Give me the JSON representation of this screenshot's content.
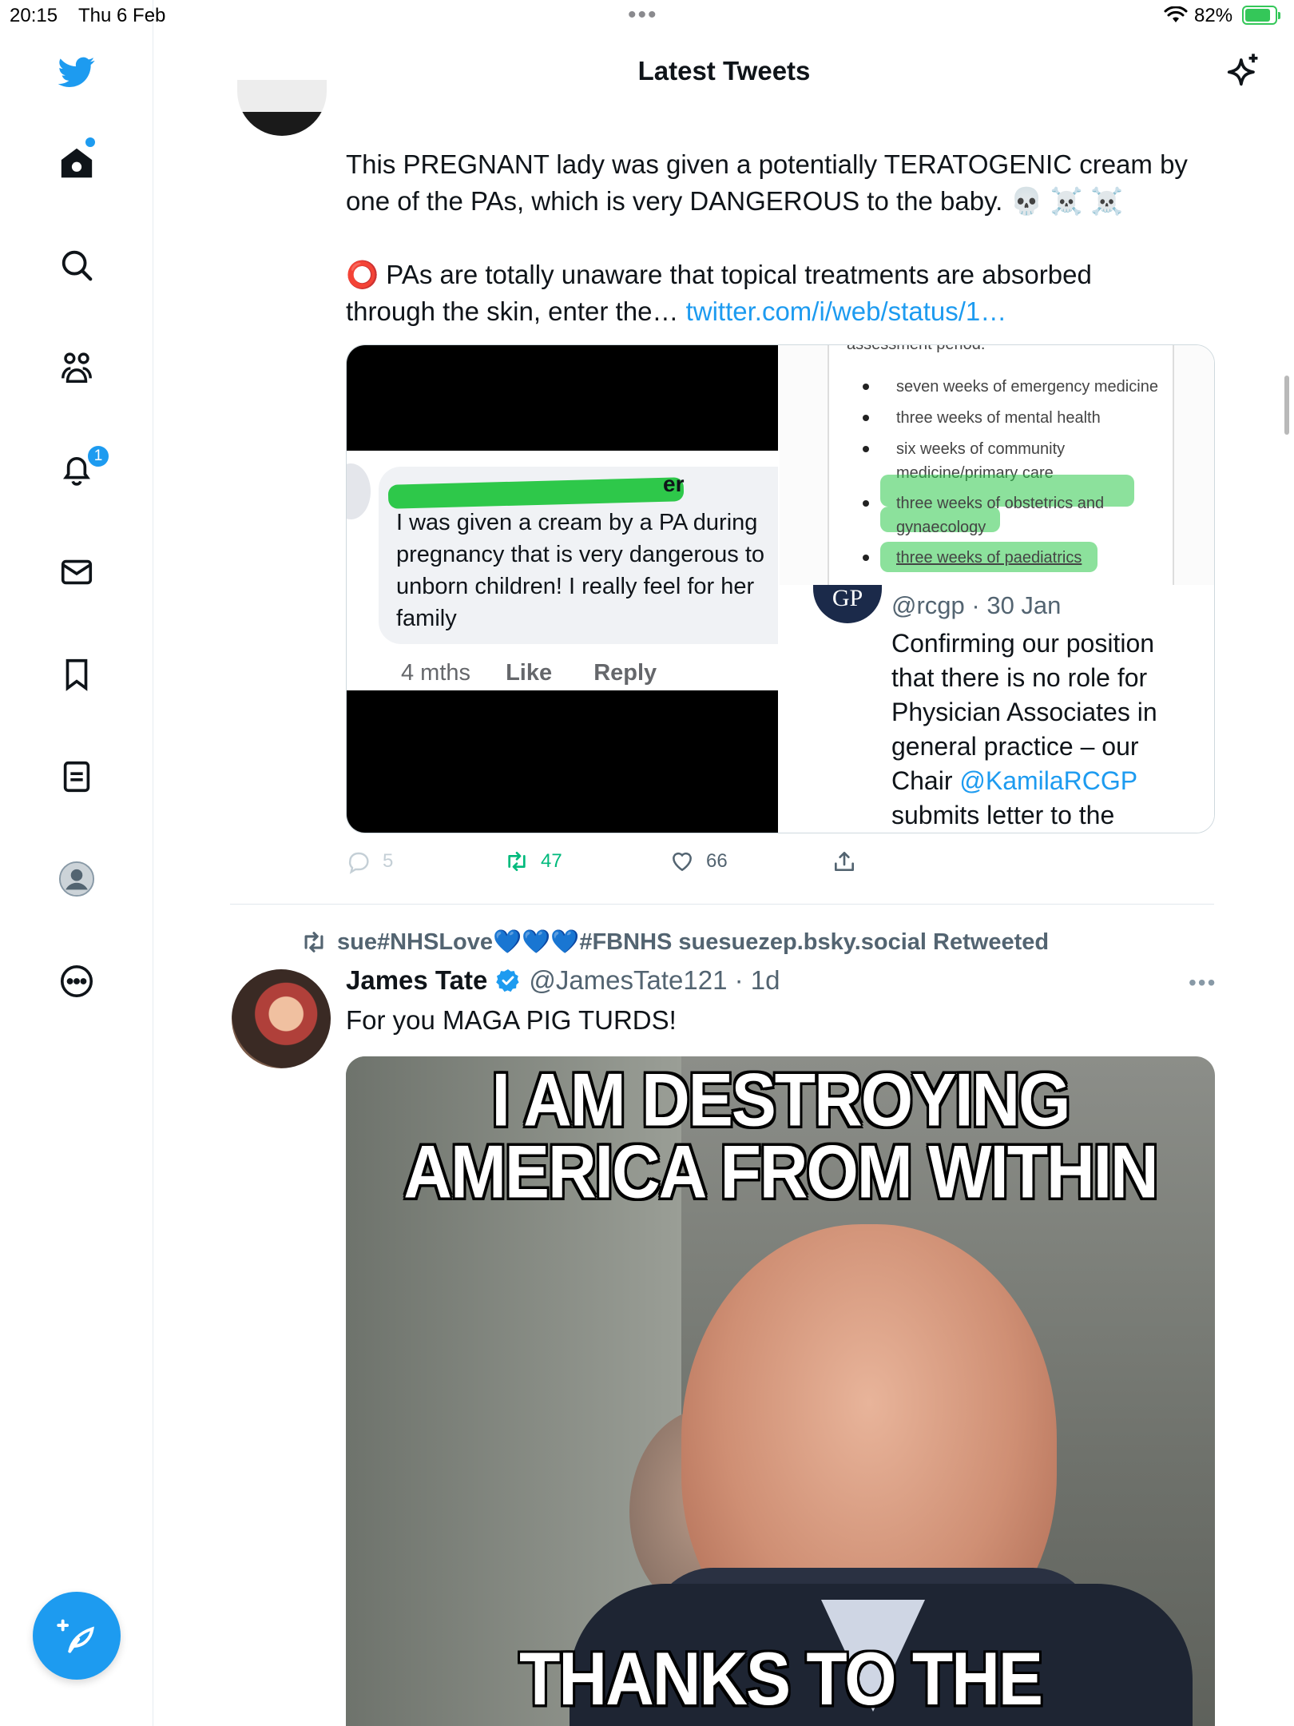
{
  "status_bar": {
    "time": "20:15",
    "date": "Thu 6 Feb",
    "battery_percent": "82%",
    "battery_level": 0.82,
    "accent": "#34c759"
  },
  "header": {
    "title": "Latest Tweets"
  },
  "sidebar": {
    "items": [
      {
        "name": "twitter-logo",
        "icon": "bird-icon"
      },
      {
        "name": "home",
        "icon": "home-icon"
      },
      {
        "name": "explore",
        "icon": "search-icon"
      },
      {
        "name": "communities",
        "icon": "people-icon"
      },
      {
        "name": "notifications",
        "icon": "bell-icon",
        "badge": "1"
      },
      {
        "name": "messages",
        "icon": "mail-icon"
      },
      {
        "name": "bookmarks",
        "icon": "bookmark-icon"
      },
      {
        "name": "lists",
        "icon": "list-icon"
      },
      {
        "name": "profile",
        "icon": "avatar-icon"
      },
      {
        "name": "more",
        "icon": "more-circle-icon"
      }
    ],
    "compose_icon": "compose-feather-icon",
    "brand_color": "#1d9bf0"
  },
  "tweet1": {
    "text_line1": "This PREGNANT lady was given a potentially TERATOGENIC cream by",
    "text_line2": "one of the PAs, which is very DANGEROUS to the baby. 💀 ☠️ ☠️",
    "text_line3": "⭕ PAs are totally unaware that topical treatments are absorbed",
    "text_line4_prefix": "through the skin, enter the… ",
    "link": "twitter.com/i/web/status/1…",
    "media_left": {
      "name_fragment": "er",
      "comment": "I was given a cream by a PA during\npregnancy that is very dangerous to\nunborn children! I really feel for her\nfamily",
      "age": "4 mths",
      "like": "Like",
      "reply": "Reply"
    },
    "media_right": {
      "doc_header": "assessment period.",
      "doc_items": [
        "seven weeks of emergency medicine",
        "three weeks of mental health",
        "six weeks of community",
        "medicine/primary care",
        "three weeks of obstetrics and",
        "gynaecology",
        "three weeks of paediatrics"
      ],
      "logo_text": "GP",
      "handle_date": "@rcgp · 30 Jan",
      "body_before_mention": "Confirming our position\nthat there is no role for\nPhysician Associates in\ngeneral practice – our\nChair ",
      "mention": "@KamilaRCGP",
      "body_after_mention": "\nsubmits letter to the"
    },
    "actions": {
      "replies": "5",
      "retweets": "47",
      "likes": "66"
    }
  },
  "tweet2": {
    "retweeted_by": "sue#NHSLove💙💙💙#FBNHS suesuezep.bsky.social Retweeted",
    "author_name": "James Tate",
    "verified": true,
    "handle_time": "@JamesTate121 · 1d",
    "text": "For you MAGA PIG TURDS!",
    "meme_top_line1": "I AM DESTROYING",
    "meme_top_line2": "AMERICA FROM WITHIN",
    "meme_bottom": "THANKS TO THE REPUBLICANS"
  }
}
